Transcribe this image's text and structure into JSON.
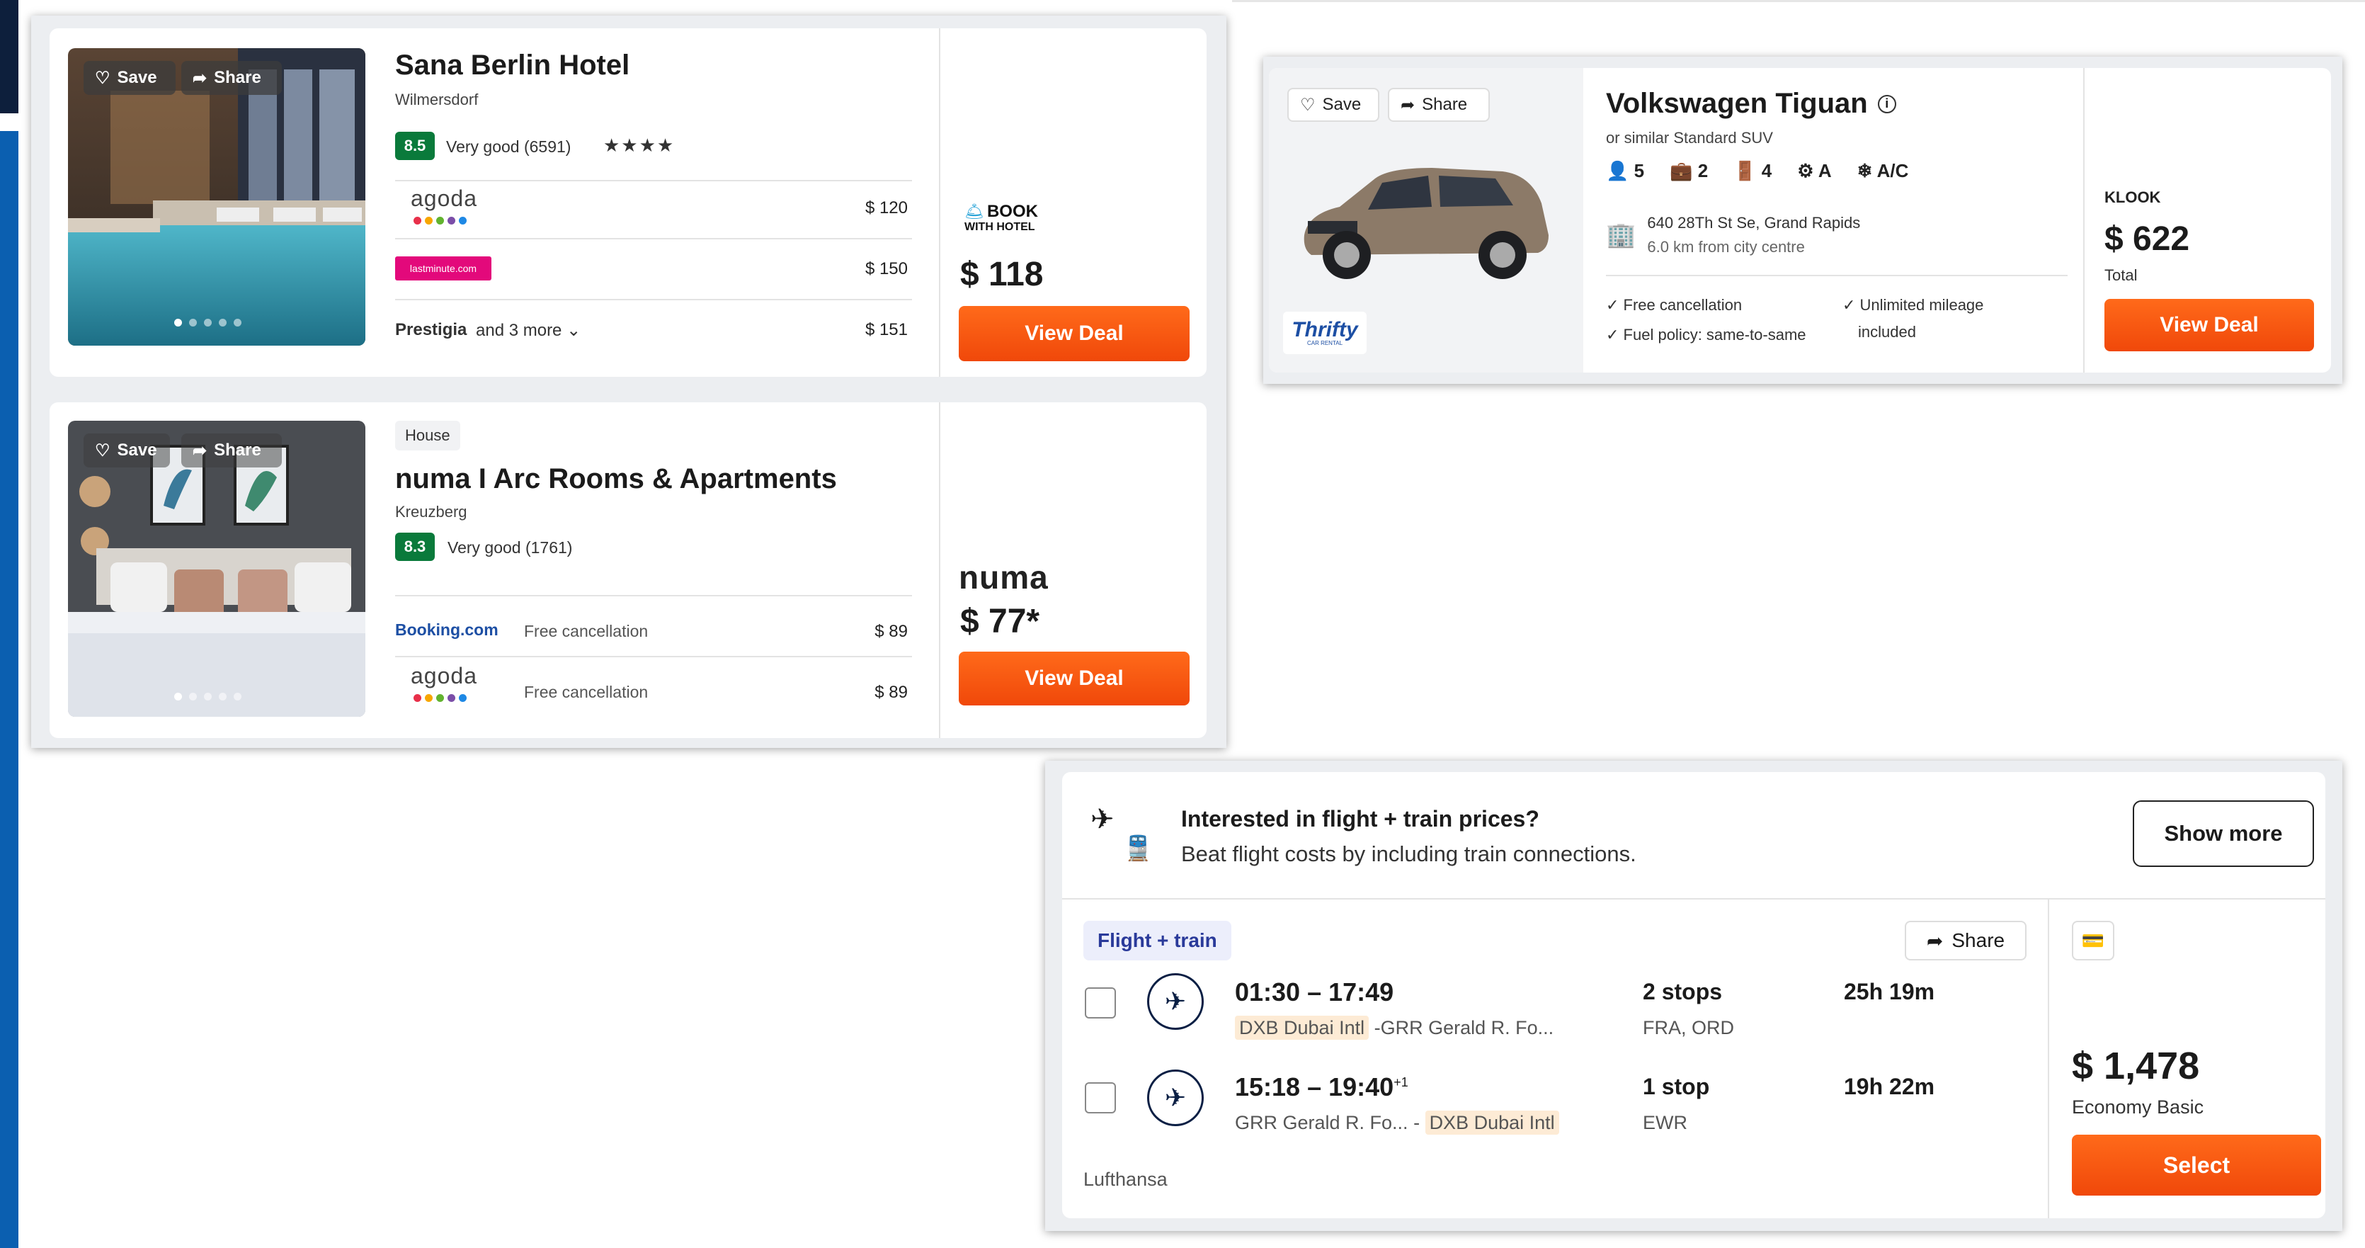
{
  "colors": {
    "accent": "#f5560f",
    "score": "#0a7a3b",
    "sidebar": "#0b5fb0",
    "highlight": "#fdebd5"
  },
  "common": {
    "save": "Save",
    "share": "Share",
    "view_deal": "View Deal"
  },
  "hotel1": {
    "name": "Sana Berlin Hotel",
    "area": "Wilmersdorf",
    "score": "8.5",
    "rating_text": "Very good (6591)",
    "stars": "★★★★",
    "providers": [
      {
        "name": "agoda",
        "price": "$ 120"
      },
      {
        "name": "lastminute.com",
        "price": "$ 150"
      },
      {
        "name": "Prestigia",
        "more": "and 3 more",
        "price": "$ 151"
      }
    ],
    "best_provider_line1": "BOOK",
    "best_provider_line2": "WITH HOTEL",
    "best_price": "$ 118",
    "photo_icon": "hotel-pool-photo"
  },
  "hotel2": {
    "type": "House",
    "name": "numa I Arc Rooms & Apartments",
    "area": "Kreuzberg",
    "score": "8.3",
    "rating_text": "Very good (1761)",
    "providers": [
      {
        "name": "Booking.com",
        "note": "Free cancellation",
        "price": "$ 89"
      },
      {
        "name": "agoda",
        "note": "Free cancellation",
        "price": "$ 89"
      }
    ],
    "best_provider": "numa",
    "best_price": "$ 77*",
    "photo_icon": "bedroom-photo"
  },
  "car": {
    "name": "Volkswagen Tiguan",
    "similar": "or similar Standard SUV",
    "seats": "5",
    "bags": "2",
    "doors": "4",
    "transmission": "A",
    "ac": "A/C",
    "address": "640 28Th St Se, Grand Rapids",
    "distance": "6.0 km from city centre",
    "features": [
      "Free cancellation",
      "Unlimited mileage",
      "Fuel policy: same-to-same",
      "included"
    ],
    "provider": "KLOOK",
    "price": "$ 622",
    "price_note": "Total",
    "agency": "Thrifty",
    "agency_sub": "CAR RENTAL"
  },
  "flight": {
    "promo_title": "Interested in flight + train prices?",
    "promo_sub": "Beat flight costs by including train connections.",
    "show_more": "Show more",
    "tag": "Flight + train",
    "share": "Share",
    "legs": [
      {
        "times": "01:30 – 17:49",
        "plus": "",
        "from": "DXB Dubai Intl",
        "sep": " -",
        "to": "GRR Gerald R. Fo...",
        "stops": "2 stops",
        "via": "FRA, ORD",
        "duration": "25h 19m"
      },
      {
        "times": "15:18 – 19:40",
        "plus": "+1",
        "from": "GRR Gerald R. Fo...",
        "sep": " - ",
        "to": "DXB Dubai Intl",
        "stops": "1 stop",
        "via": "EWR",
        "duration": "19h 22m"
      }
    ],
    "airline": "Lufthansa",
    "price": "$ 1,478",
    "fare": "Economy Basic",
    "select": "Select"
  }
}
